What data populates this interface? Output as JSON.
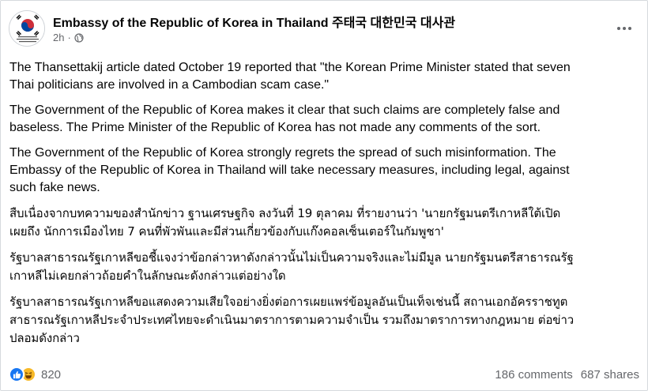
{
  "post": {
    "page_name": "Embassy of the Republic of Korea in Thailand 주태국 대한민국 대사관",
    "time": "2h",
    "separator": "·",
    "avatar_caption": "Embassy of the Republic of Korea in Thailand",
    "paragraphs": [
      "The Thansettakij article dated October 19 reported that \"the Korean Prime Minister stated that seven\nThai politicians are involved in a Cambodian scam case.\"",
      "The Government of the Republic of Korea makes it clear that such claims are completely false and\nbaseless. The Prime Minister of the Republic of Korea has not made any comments of the sort.",
      "The Government of the Republic of Korea strongly regrets the spread of such misinformation. The\nEmbassy of the Republic of Korea in Thailand will take necessary measures, including legal, against\nsuch fake news."
    ],
    "thai_paragraphs": [
      "สืบเนื่องจากบทความของสำนักข่าว ฐานเศรษฐกิจ ลงวันที่ 19 ตุลาคม ที่รายงานว่า 'นายกรัฐมนตรีเกาหลีใต้เปิด\nเผยถึง นักการเมืองไทย 7 คนที่พัวพันและมีส่วนเกี่ยวข้องกับแก๊งคอลเซ็นเตอร์ในกัมพูชา'",
      "รัฐบาลสาธารณรัฐเกาหลีขอชี้แจงว่าข้อกล่าวหาดังกล่าวนั้นไม่เป็นความจริงและไม่มีมูล นายกรัฐมนตรีสาธารณรัฐ\nเกาหลีไม่เคยกล่าวถ้อยคำในลักษณะดังกล่าวแต่อย่างใด",
      "รัฐบาลสาธารณรัฐเกาหลีขอแสดงความเสียใจอย่างยิ่งต่อการเผยแพร่ข้อมูลอันเป็นเท็จเช่นนี้ สถานเอกอัครราชทูต\nสาธารณรัฐเกาหลีประจำประเทศไทยจะดำเนินมาตราการตามความจำเป็น รวมถึงมาตราการทางกฎหมาย ต่อข่าว\nปลอมดังกล่าว"
    ],
    "reactions_count": "820",
    "comments": "186 comments",
    "shares": "687 shares",
    "icons": [
      "korea-flag-avatar",
      "globe-icon",
      "more-icon",
      "like-icon",
      "haha-icon"
    ],
    "colors": {
      "like": "#1877f2",
      "haha": "#f7b928",
      "meta_text": "#65676b"
    }
  }
}
